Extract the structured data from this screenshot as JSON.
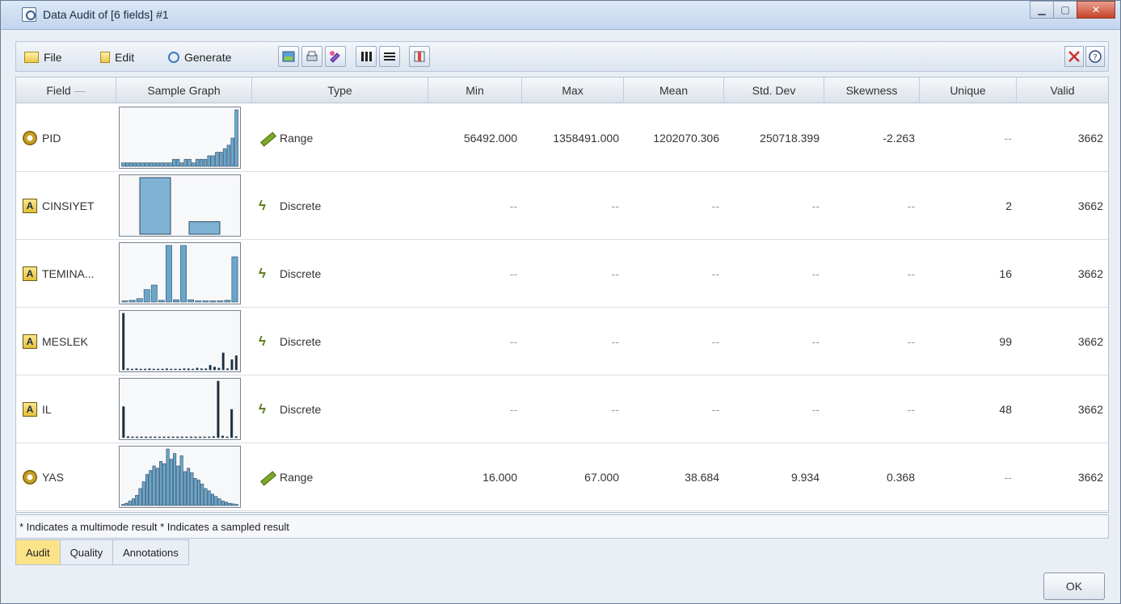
{
  "window": {
    "title": "Data Audit of [6 fields] #1"
  },
  "menu": {
    "file": "File",
    "edit": "Edit",
    "generate": "Generate"
  },
  "columns": [
    "Field",
    "Sample Graph",
    "Type",
    "Min",
    "Max",
    "Mean",
    "Std. Dev",
    "Skewness",
    "Unique",
    "Valid"
  ],
  "rows": [
    {
      "field": "PID",
      "icon": "range",
      "type": "Range",
      "min": "56492.000",
      "max": "1358491.000",
      "mean": "1202070.306",
      "std": "250718.399",
      "skew": "-2.263",
      "unique": "--",
      "valid": "3662",
      "graph": {
        "kind": "histogram",
        "bars": [
          1,
          1,
          1,
          1,
          1,
          1,
          1,
          1,
          1,
          1,
          1,
          1,
          1,
          2,
          2,
          1,
          2,
          2,
          1,
          2,
          2,
          2,
          3,
          3,
          4,
          4,
          5,
          6,
          8,
          16
        ]
      }
    },
    {
      "field": "CINSIYET",
      "icon": "text",
      "type": "Discrete",
      "min": "--",
      "max": "--",
      "mean": "--",
      "std": "--",
      "skew": "--",
      "unique": "2",
      "valid": "3662",
      "graph": {
        "kind": "bars",
        "bars": [
          100,
          22
        ]
      }
    },
    {
      "field": "TEMINA...",
      "icon": "text",
      "type": "Discrete",
      "min": "--",
      "max": "--",
      "mean": "--",
      "std": "--",
      "skew": "--",
      "unique": "16",
      "valid": "3662",
      "graph": {
        "kind": "histogram",
        "bars": [
          2,
          3,
          6,
          22,
          30,
          3,
          100,
          4,
          100,
          4,
          2,
          2,
          2,
          2,
          3,
          80
        ]
      }
    },
    {
      "field": "MESLEK",
      "icon": "text",
      "type": "Discrete",
      "min": "--",
      "max": "--",
      "mean": "--",
      "std": "--",
      "skew": "--",
      "unique": "99",
      "valid": "3662",
      "graph": {
        "kind": "spikes",
        "bars": [
          100,
          2,
          1,
          2,
          1,
          1,
          2,
          1,
          1,
          1,
          2,
          1,
          1,
          1,
          2,
          2,
          1,
          3,
          2,
          2,
          8,
          5,
          3,
          30,
          2,
          18,
          25
        ]
      }
    },
    {
      "field": "IL",
      "icon": "text",
      "type": "Discrete",
      "min": "--",
      "max": "--",
      "mean": "--",
      "std": "--",
      "skew": "--",
      "unique": "48",
      "valid": "3662",
      "graph": {
        "kind": "spikes",
        "bars": [
          55,
          2,
          1,
          1,
          1,
          1,
          1,
          1,
          1,
          1,
          1,
          1,
          1,
          1,
          1,
          1,
          1,
          1,
          1,
          1,
          2,
          100,
          3,
          1,
          50,
          2
        ]
      }
    },
    {
      "field": "YAS",
      "icon": "range",
      "type": "Range",
      "min": "16.000",
      "max": "67.000",
      "mean": "38.684",
      "std": "9.934",
      "skew": "0.368",
      "unique": "--",
      "valid": "3662",
      "graph": {
        "kind": "histogram",
        "bars": [
          2,
          4,
          8,
          12,
          18,
          30,
          42,
          55,
          62,
          70,
          66,
          78,
          74,
          100,
          82,
          92,
          70,
          88,
          60,
          66,
          58,
          48,
          45,
          38,
          30,
          26,
          20,
          16,
          12,
          8,
          6,
          4,
          3,
          2
        ]
      }
    }
  ],
  "footer_text": "* Indicates a multimode result   * Indicates a sampled result",
  "tabs": [
    "Audit",
    "Quality",
    "Annotations"
  ],
  "ok_label": "OK"
}
